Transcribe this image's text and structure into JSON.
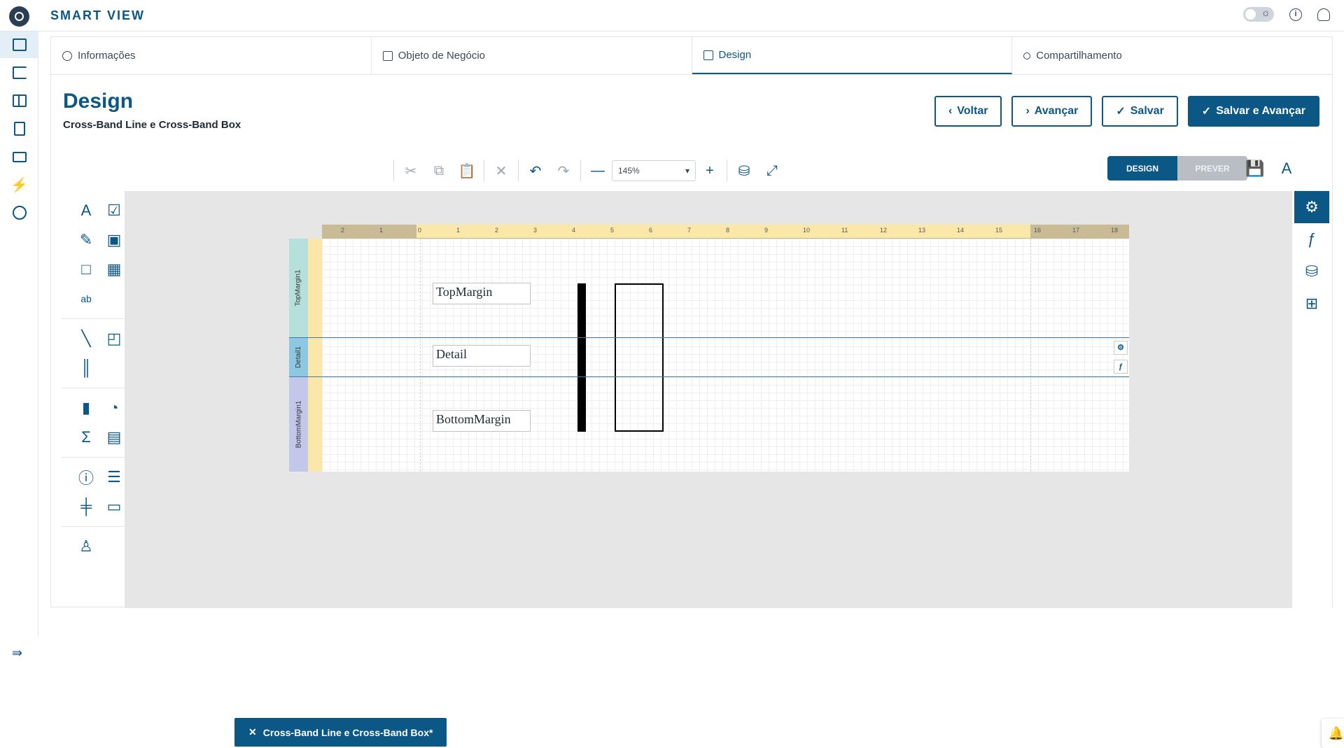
{
  "app": {
    "title": "SMART VIEW"
  },
  "tabs": [
    {
      "label": "Informações",
      "icon": "info-icon"
    },
    {
      "label": "Objeto de Negócio",
      "icon": "briefcase-icon"
    },
    {
      "label": "Design",
      "icon": "image-icon",
      "active": true
    },
    {
      "label": "Compartilhamento",
      "icon": "share-icon"
    }
  ],
  "page": {
    "title": "Design",
    "subtitle": "Cross-Band Line e Cross-Band Box"
  },
  "actions": {
    "back": "Voltar",
    "next": "Avançar",
    "save": "Salvar",
    "save_next": "Salvar e Avançar"
  },
  "toolbar": {
    "zoom": "145%"
  },
  "mode": {
    "design": "DESIGN",
    "preview": "PREVER"
  },
  "report": {
    "bands": [
      "TopMargin1",
      "Detail1",
      "BottomMargin1"
    ],
    "labels": [
      "TopMargin",
      "Detail",
      "BottomMargin"
    ],
    "ruler_numbers": [
      "2",
      "1",
      "0",
      "1",
      "2",
      "3",
      "4",
      "5",
      "6",
      "7",
      "8",
      "9",
      "10",
      "11",
      "12",
      "13",
      "14",
      "15",
      "16",
      "17",
      "18"
    ]
  },
  "doc_tab": {
    "label": "Cross-Band Line e Cross-Band Box*"
  },
  "colors": {
    "accent": "#0b5785",
    "canvas": "#e6e6e6",
    "ruler": "#fbe7a8"
  }
}
